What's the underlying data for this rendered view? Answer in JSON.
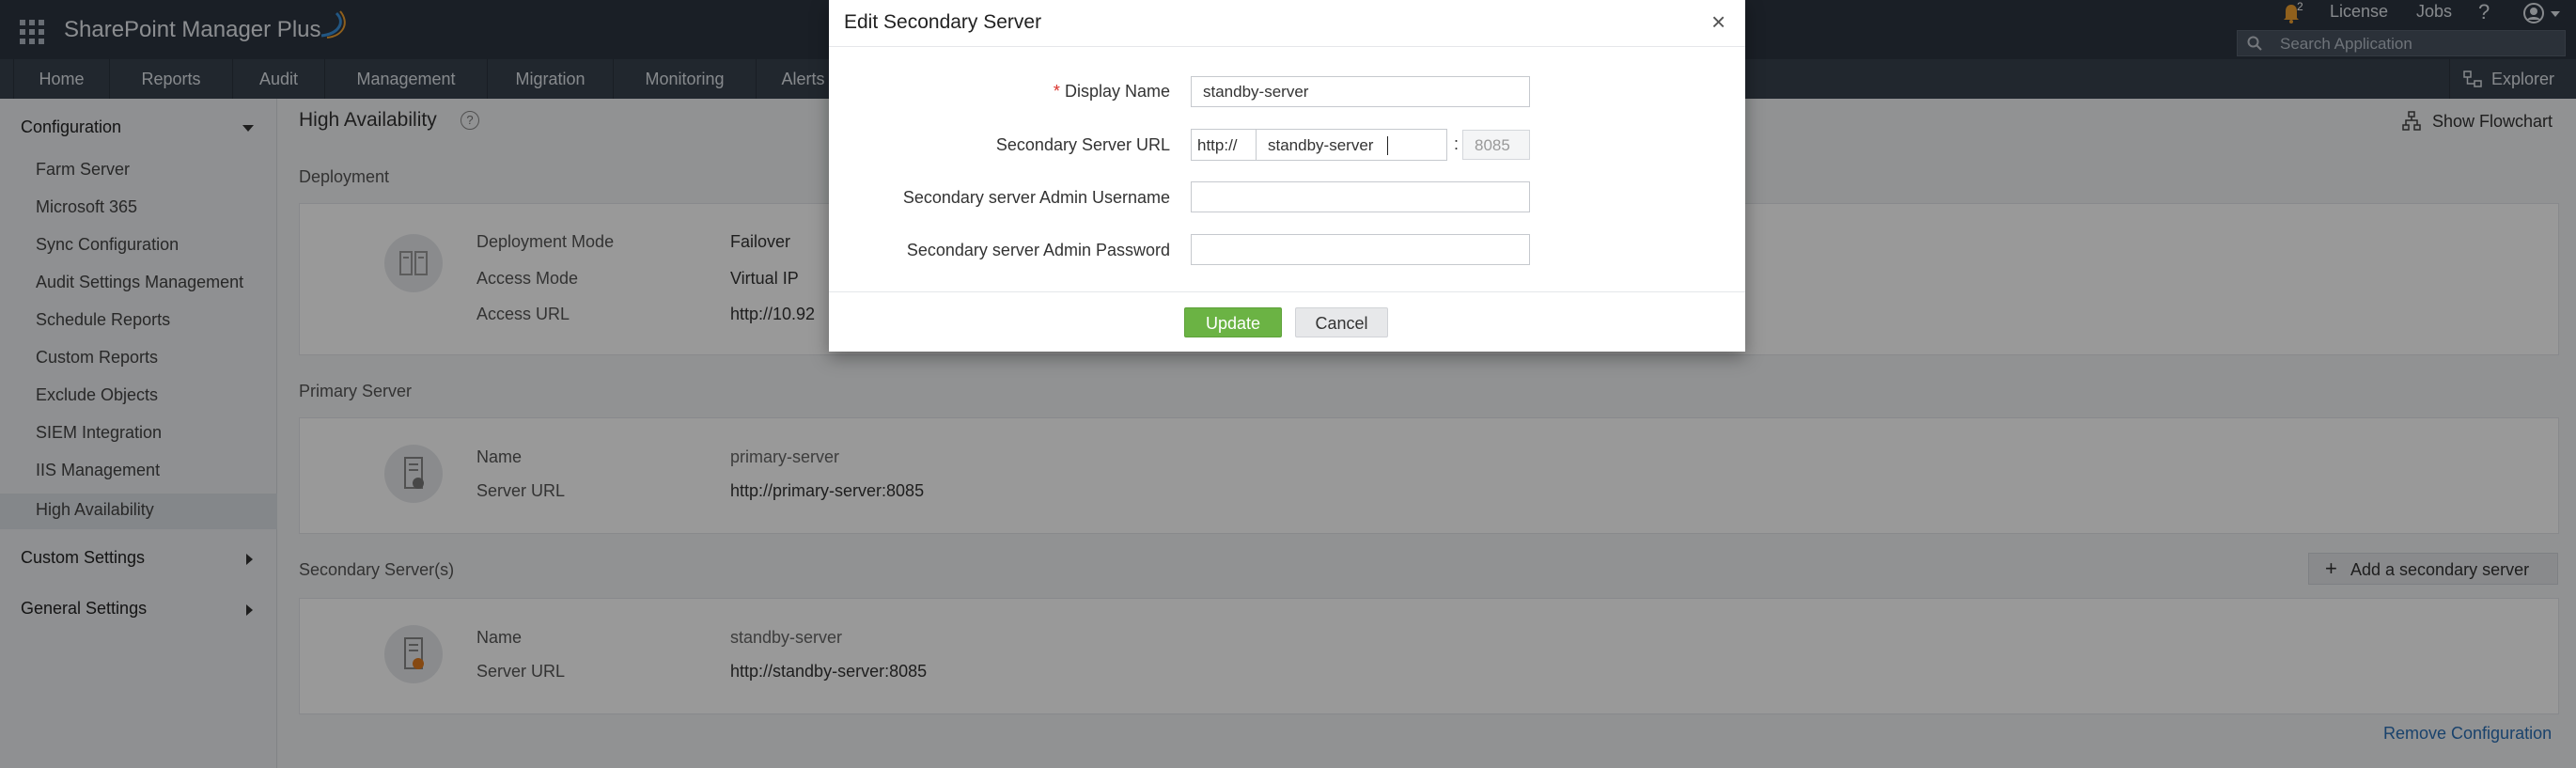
{
  "app": {
    "title": "SharePoint Manager Plus"
  },
  "header": {
    "notification_count": "2",
    "license_label": "License",
    "jobs_label": "Jobs",
    "help_label": "?",
    "search_placeholder": "Search Application",
    "explorer_label": "Explorer"
  },
  "nav": {
    "tabs": [
      "Home",
      "Reports",
      "Audit",
      "Management",
      "Migration",
      "Monitoring",
      "Alerts"
    ]
  },
  "sidebar": {
    "configuration_label": "Configuration",
    "items": [
      "Farm Server",
      "Microsoft 365",
      "Sync Configuration",
      "Audit Settings Management",
      "Schedule Reports",
      "Custom Reports",
      "Exclude Objects",
      "SIEM Integration",
      "IIS Management",
      "High Availability"
    ],
    "active_item": "High Availability",
    "custom_settings_label": "Custom Settings",
    "general_settings_label": "General Settings"
  },
  "page": {
    "title": "High Availability",
    "help_icon": "?",
    "show_flowchart_label": "Show Flowchart",
    "deployment_title": "Deployment",
    "deployment": {
      "mode_label": "Deployment Mode",
      "mode_value": "Failover",
      "access_mode_label": "Access Mode",
      "access_mode_value": "Virtual IP",
      "access_url_label": "Access URL",
      "access_url_value": "http://10.92"
    },
    "primary_title": "Primary Server",
    "primary": {
      "name_label": "Name",
      "name_value": "primary-server",
      "url_label": "Server URL",
      "url_value": "http://primary-server:8085"
    },
    "secondary_title": "Secondary Server(s)",
    "add_secondary_label": "Add a secondary server",
    "secondary": {
      "name_label": "Name",
      "name_value": "standby-server",
      "url_label": "Server URL",
      "url_value": "http://standby-server:8085"
    },
    "remove_config_label": "Remove Configuration"
  },
  "dialog": {
    "title": "Edit Secondary Server",
    "close_icon": "×",
    "required_mark": "*",
    "display_name_label": "Display Name",
    "display_name_value": "standby-server",
    "url_label": "Secondary Server URL",
    "url_prefix": "http://",
    "url_host_value": "standby-server",
    "url_separator": ":",
    "url_port_value": "8085",
    "username_label": "Secondary server Admin Username",
    "username_value": "",
    "password_label": "Secondary server Admin Password",
    "password_value": "",
    "update_label": "Update",
    "cancel_label": "Cancel"
  },
  "colors": {
    "header_bg": "#2c3440",
    "nav_bg": "#37414e",
    "update_green": "#6bb344",
    "link_blue": "#2a6fb5",
    "notification_orange": "#f0a030"
  }
}
